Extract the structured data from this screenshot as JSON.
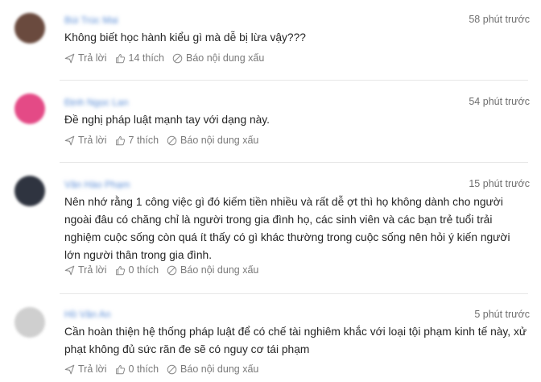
{
  "comments": [
    {
      "author": "Bùi Trúc Mai",
      "time": "58 phút trước",
      "text": "Không biết học hành kiểu gì mà dễ bị lừa vậy???",
      "reply_label": "Trả lời",
      "like_label": "14 thích",
      "report_label": "Báo nội dung xấu",
      "avatar_color": "#6a4a3e"
    },
    {
      "author": "Định Ngọc Lan",
      "time": "54 phút trước",
      "text": "Đề nghị pháp luật mạnh tay với dạng này.",
      "reply_label": "Trả lời",
      "like_label": "7 thích",
      "report_label": "Báo nội dung xấu",
      "avatar_color": "#e44a86"
    },
    {
      "author": "Văn Hào Phạm",
      "time": "15 phút trước",
      "lines": [
        "Nên nhớ rằng 1 công việc gì đó kiếm tiền nhiều và rất dễ ợt thì họ không dành cho người",
        "ngoài đâu có chăng chỉ là người trong gia đình họ, các sinh viên và các bạn trẻ tuổi trải",
        "nghiệm cuộc sống còn quá ít thấy có gì khác thường trong cuộc sống nên hỏi ý kiến người",
        "lớn người thân trong gia đình."
      ],
      "reply_label": "Trả lời",
      "like_label": "0 thích",
      "report_label": "Báo nội dung xấu",
      "avatar_color": "#2f3440"
    },
    {
      "author": "Hồ Văn An",
      "time": "5 phút trước",
      "lines": [
        "Cần hoàn thiện hệ thống pháp luật để có chế tài nghiêm khắc với loại tội phạm kinh tế này, xử",
        "phạt không đủ sức răn đe sẽ có nguy cơ tái phạm"
      ],
      "reply_label": "Trả lời",
      "like_label": "0 thích",
      "report_label": "Báo nội dung xấu",
      "avatar_color": "#cfcfcf"
    }
  ],
  "colors": {
    "author_link": "#5b8dd6",
    "meta_text": "#7a7a7a",
    "divider": "#e7e7e7"
  },
  "icons": {
    "reply": "reply-arrow-icon",
    "like": "thumbs-up-icon",
    "report": "report-flag-icon"
  }
}
